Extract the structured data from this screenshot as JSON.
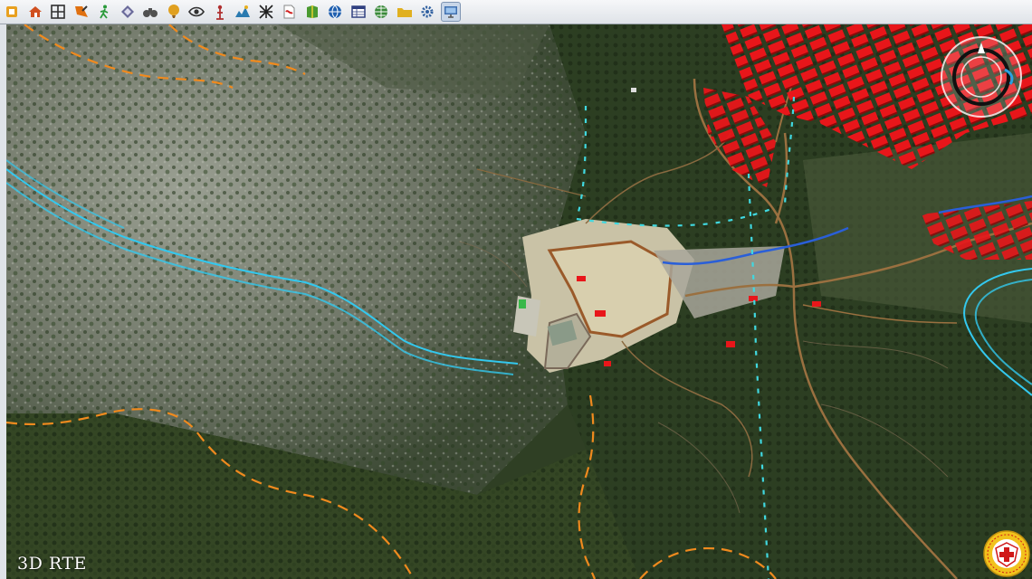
{
  "app": {
    "label": "3D RTE"
  },
  "toolbar": {
    "buttons": [
      {
        "icon": "layer-panel-icon",
        "color": "#e8a020"
      },
      {
        "icon": "home-icon",
        "color": "#d05020"
      },
      {
        "icon": "grid-icon",
        "color": "#303030"
      },
      {
        "icon": "pencil-draw-icon",
        "color": "#e07010"
      },
      {
        "icon": "walk-person-icon",
        "color": "#2a9a3a"
      },
      {
        "icon": "tile-icon",
        "color": "#6a6a9a"
      },
      {
        "icon": "binoculars-icon",
        "color": "#505050"
      },
      {
        "icon": "balloon-icon",
        "color": "#e0a020"
      },
      {
        "icon": "eye-icon",
        "color": "#303030"
      },
      {
        "icon": "antenna-icon",
        "color": "#b03030"
      },
      {
        "icon": "terrain-profile-icon",
        "color": "#2a7ab0"
      },
      {
        "icon": "pattern-icon",
        "color": "#202020"
      },
      {
        "icon": "pdf-export-icon",
        "color": "#d02020"
      },
      {
        "icon": "map-layers-icon",
        "color": "#4a9a30"
      },
      {
        "icon": "globe-icon",
        "color": "#2060b0"
      },
      {
        "icon": "table-icon",
        "color": "#304080"
      },
      {
        "icon": "web-globe-icon",
        "color": "#3a8a3a"
      },
      {
        "icon": "folder-icon",
        "color": "#e0b020"
      },
      {
        "icon": "settings-gear-icon",
        "color": "#3060a0"
      },
      {
        "icon": "monitor-icon",
        "color": "#4070b0",
        "active": true
      }
    ]
  },
  "map": {
    "layers": [
      {
        "type": "stream",
        "color": "#33c8ee"
      },
      {
        "type": "river",
        "color": "#2a7fd8"
      },
      {
        "type": "trail",
        "color": "#f08a1e"
      },
      {
        "type": "boundary",
        "color": "#40d8e0"
      },
      {
        "type": "road",
        "color": "#9a7040"
      },
      {
        "type": "buildings",
        "color": "#e8161a"
      }
    ]
  }
}
